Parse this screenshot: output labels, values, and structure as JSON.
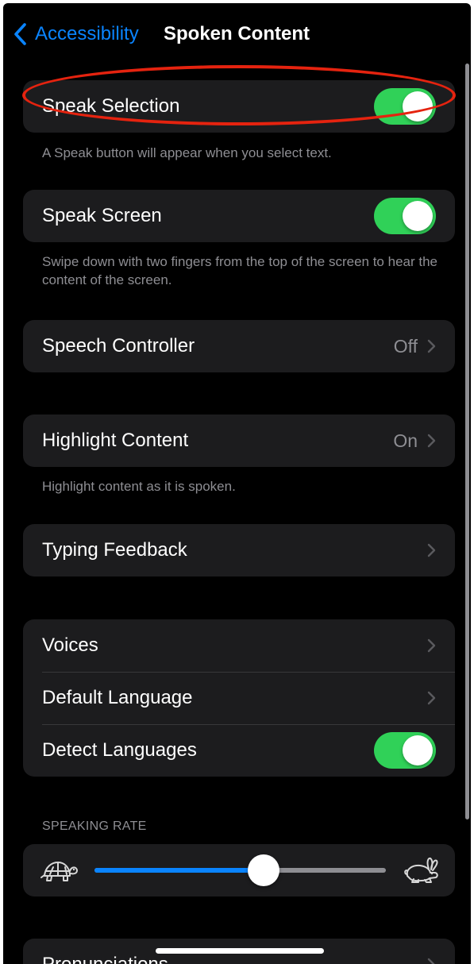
{
  "nav": {
    "back_label": "Accessibility",
    "title": "Spoken Content"
  },
  "speak_selection": {
    "label": "Speak Selection",
    "enabled": true,
    "footer": "A Speak button will appear when you select text."
  },
  "speak_screen": {
    "label": "Speak Screen",
    "enabled": true,
    "footer": "Swipe down with two fingers from the top of the screen to hear the content of the screen."
  },
  "speech_controller": {
    "label": "Speech Controller",
    "value": "Off"
  },
  "highlight_content": {
    "label": "Highlight Content",
    "value": "On",
    "footer": "Highlight content as it is spoken."
  },
  "typing_feedback": {
    "label": "Typing Feedback"
  },
  "voices_group": {
    "voices_label": "Voices",
    "default_language_label": "Default Language",
    "detect_languages_label": "Detect Languages",
    "detect_languages_enabled": true
  },
  "speaking_rate": {
    "header": "SPEAKING RATE",
    "level": 0.58
  },
  "pronunciations": {
    "label": "Pronunciations"
  },
  "colors": {
    "accent": "#0a84ff",
    "toggle_on": "#30d158",
    "annotation_ring": "#e5230f",
    "cell_bg": "#1c1c1e",
    "secondary_text": "#8e8e93"
  },
  "icons": {
    "back": "chevron-left-icon",
    "disclosure": "chevron-right-icon",
    "slow": "turtle-icon",
    "fast": "rabbit-icon"
  }
}
